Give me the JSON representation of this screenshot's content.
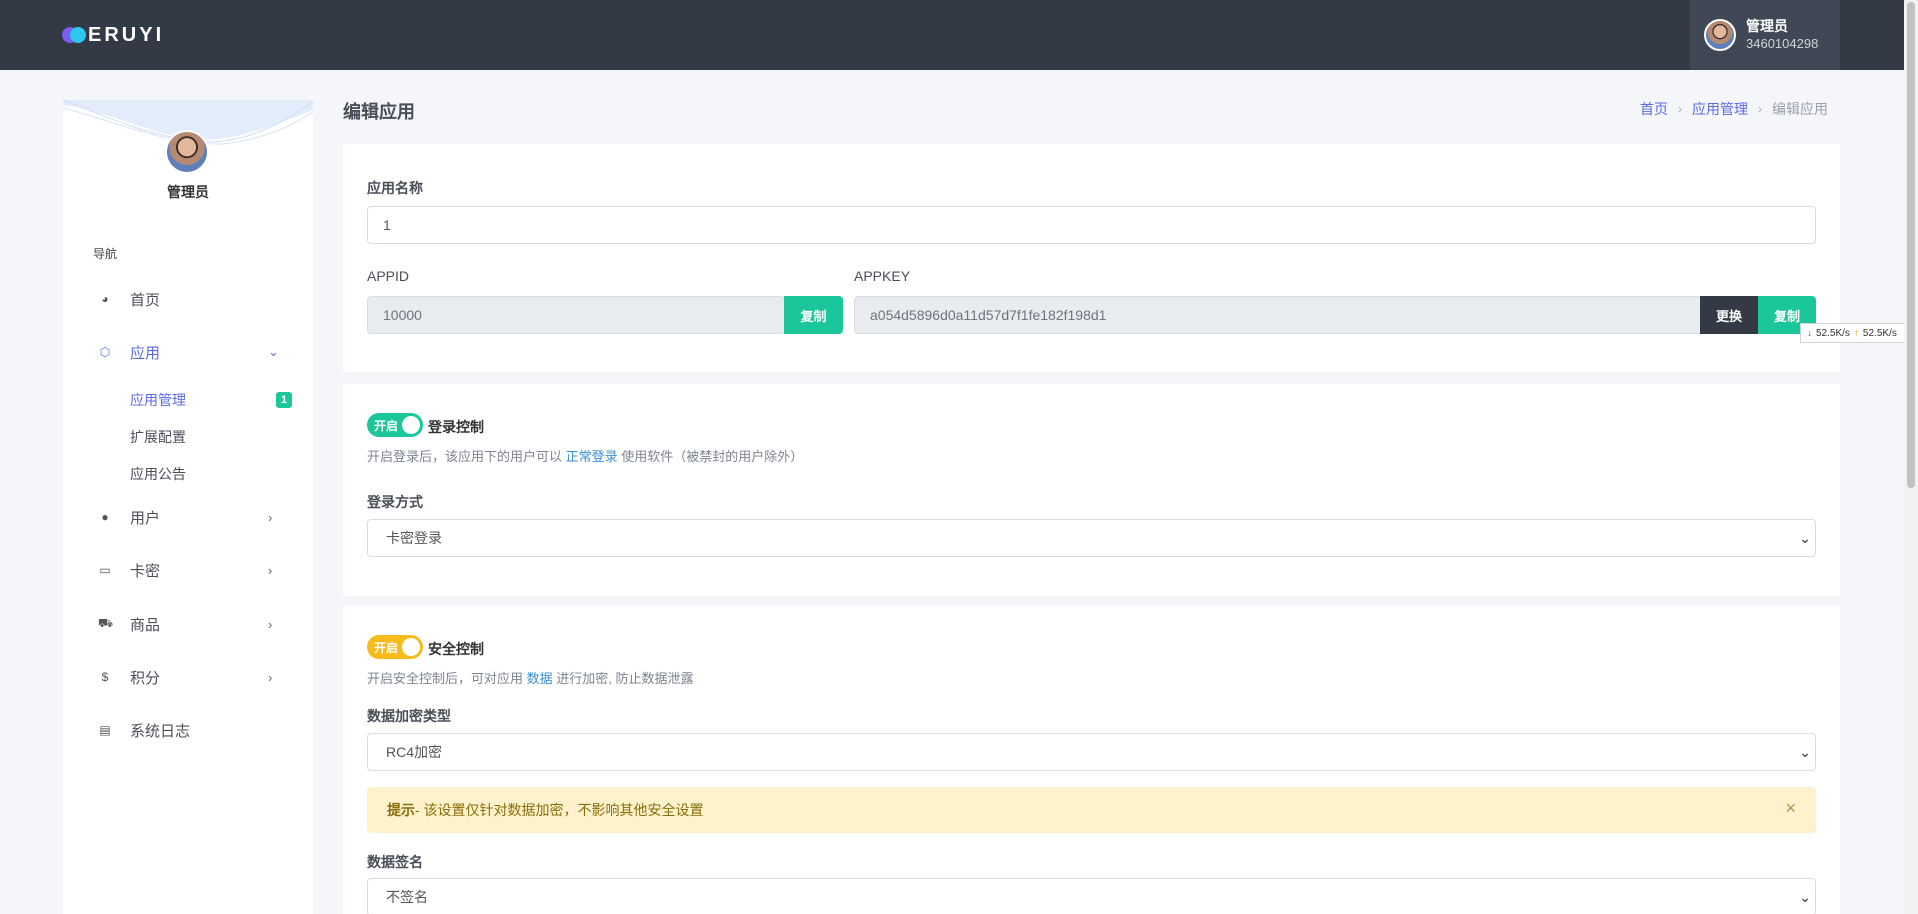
{
  "app": {
    "logo_text": "ERUYI"
  },
  "user": {
    "name": "管理员",
    "id": "3460104298"
  },
  "sidebar": {
    "admin_name": "管理员",
    "nav_title": "导航",
    "items": [
      {
        "label": "首页",
        "icon": "dashboard-icon"
      },
      {
        "label": "应用",
        "icon": "cube-icon",
        "expanded": true
      },
      {
        "label": "用户",
        "icon": "user-icon"
      },
      {
        "label": "卡密",
        "icon": "card-icon"
      },
      {
        "label": "商品",
        "icon": "cart-icon"
      },
      {
        "label": "积分",
        "icon": "coin-icon"
      },
      {
        "label": "系统日志",
        "icon": "log-icon"
      }
    ],
    "sub_items": [
      {
        "label": "应用管理",
        "badge": "1",
        "active": true
      },
      {
        "label": "扩展配置"
      },
      {
        "label": "应用公告"
      }
    ]
  },
  "page": {
    "title": "编辑应用",
    "breadcrumb": [
      "首页",
      "应用管理",
      "编辑应用"
    ]
  },
  "app_info": {
    "name_label": "应用名称",
    "name_value": "1",
    "appid_label": "APPID",
    "appid_value": "10000",
    "appkey_label": "APPKEY",
    "appkey_value": "a054d5896d0a11d57d7f1fe182f198d1",
    "copy_label": "复制",
    "change_label": "更换"
  },
  "login_control": {
    "toggle_text": "开启",
    "title": "登录控制",
    "help_prefix": "开启登录后，该应用下的用户可以",
    "help_highlight": "正常登录",
    "help_suffix": "使用软件（被禁封的用户除外）",
    "method_label": "登录方式",
    "method_value": "卡密登录"
  },
  "security_control": {
    "toggle_text": "开启",
    "title": "安全控制",
    "help_prefix": "开启安全控制后，可对应用",
    "help_highlight": "数据",
    "help_suffix": "进行加密, 防止数据泄露",
    "encrypt_label": "数据加密类型",
    "encrypt_value": "RC4加密",
    "alert_bold": "提示",
    "alert_text": " - 该设置仅针对数据加密，不影响其他安全设置",
    "sign_label": "数据签名",
    "sign_value": "不签名"
  },
  "speed_widget": {
    "down": "52.5K/s",
    "up": "52.5K/s"
  },
  "colors": {
    "accent": "#5b6be8",
    "green": "#1bc69b",
    "yellow": "#f9bb1b",
    "topbar": "#333a46"
  }
}
